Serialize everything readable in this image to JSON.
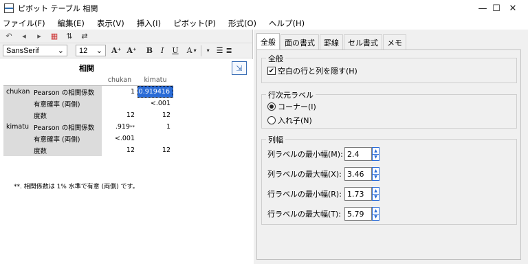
{
  "window": {
    "title": "ピボット テーブル 相関",
    "icon": "pivot-table-app-icon"
  },
  "menu": [
    {
      "label": "ファイル(F)"
    },
    {
      "label": "編集(E)"
    },
    {
      "label": "表示(V)"
    },
    {
      "label": "挿入(I)"
    },
    {
      "label": "ピボット(P)"
    },
    {
      "label": "形式(O)"
    },
    {
      "label": "ヘルプ(H)"
    }
  ],
  "toolbar": {
    "font_name": "SansSerif",
    "font_size": "12",
    "bold_label": "B",
    "italic_label": "I",
    "underline_label": "U",
    "color_label": "A"
  },
  "pivot": {
    "title": "相関",
    "col_headers": [
      "chukan",
      "kimatu"
    ],
    "rows": [
      {
        "var": "chukan",
        "stat": "Pearson の相関係数",
        "v1": "1",
        "v2": "0.919416"
      },
      {
        "var": "",
        "stat": "有意確率 (両側)",
        "v1": "",
        "v2": "<.001"
      },
      {
        "var": "",
        "stat": "度数",
        "v1": "12",
        "v2": "12"
      },
      {
        "var": "kimatu",
        "stat": "Pearson の相関係数",
        "v1": ".919",
        "v1_sup": "**",
        "v2": "1"
      },
      {
        "var": "",
        "stat": "有意確率 (両側)",
        "v1": "<.001",
        "v2": ""
      },
      {
        "var": "",
        "stat": "度数",
        "v1": "12",
        "v2": "12"
      }
    ],
    "footnote": "**. 相関係数は 1% 水準で有意 (両側) です。"
  },
  "tabs": [
    {
      "label": "全般",
      "active": true
    },
    {
      "label": "面の書式",
      "active": false
    },
    {
      "label": "罫線",
      "active": false
    },
    {
      "label": "セル書式",
      "active": false
    },
    {
      "label": "メモ",
      "active": false
    }
  ],
  "general": {
    "group_label": "全般",
    "hide_empty_label": "空白の行と列を隠す(H)",
    "hide_empty_checked": true
  },
  "row_dimension": {
    "group_label": "行次元ラベル",
    "corner_label": "コーナー(I)",
    "nested_label": "入れ子(N)",
    "selected": "コーナー(I)"
  },
  "column_width": {
    "group_label": "列幅",
    "fields": [
      {
        "label": "列ラベルの最小幅(M):",
        "value": "2.4"
      },
      {
        "label": "列ラベルの最大幅(X):",
        "value": "3.46"
      },
      {
        "label": "行ラベルの最小幅(R):",
        "value": "1.73"
      },
      {
        "label": "行ラベルの最大幅(T):",
        "value": "5.79"
      }
    ]
  }
}
